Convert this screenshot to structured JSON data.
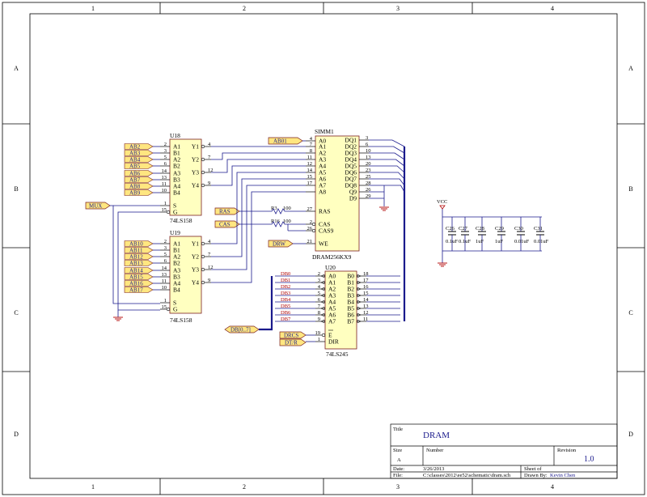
{
  "frame": {
    "cols": [
      "1",
      "2",
      "3",
      "4"
    ],
    "rows": [
      "A",
      "B",
      "C",
      "D"
    ]
  },
  "u18": {
    "ref": "U18",
    "part": "74LS158",
    "inputs": [
      "A1",
      "B1",
      "A2",
      "B2",
      "A3",
      "B3",
      "A4",
      "B4"
    ],
    "input_pins": [
      "2",
      "3",
      "5",
      "6",
      "14",
      "13",
      "11",
      "10"
    ],
    "outputs": [
      "Y1",
      "Y2",
      "Y3",
      "Y4"
    ],
    "output_pins": [
      "4",
      "7",
      "12",
      "9"
    ],
    "ctrl": [
      "S",
      "G"
    ],
    "ctrl_pins": [
      "1",
      "15"
    ],
    "ports": [
      "AB2",
      "AB3",
      "AB4",
      "AB5",
      "AB6",
      "AB7",
      "AB8",
      "AB9"
    ]
  },
  "u19": {
    "ref": "U19",
    "part": "74LS158",
    "inputs": [
      "A1",
      "B1",
      "A2",
      "B2",
      "A3",
      "B3",
      "A4",
      "B4"
    ],
    "input_pins": [
      "2",
      "3",
      "5",
      "6",
      "14",
      "13",
      "11",
      "10"
    ],
    "outputs": [
      "Y1",
      "Y2",
      "Y3",
      "Y4"
    ],
    "output_pins": [
      "4",
      "7",
      "12",
      "9"
    ],
    "ctrl": [
      "S",
      "G"
    ],
    "ctrl_pins": [
      "1",
      "15"
    ],
    "ports": [
      "AB10",
      "AB11",
      "AB12",
      "AB13",
      "AB14",
      "AB15",
      "AB16",
      "AB17"
    ]
  },
  "mux_port": "MUX",
  "simm": {
    "ref": "SIMM1",
    "part": "DRAM256KX9",
    "addr": [
      "A0",
      "A1",
      "A2",
      "A3",
      "A4",
      "A5",
      "A6",
      "A7",
      "A8"
    ],
    "addr_pins": [
      "4",
      "7",
      "8",
      "11",
      "12",
      "14",
      "15",
      "17"
    ],
    "dq": [
      "DQ1",
      "DQ2",
      "DQ3",
      "DQ4",
      "DQ5",
      "DQ6",
      "DQ7",
      "DQ8",
      "Q9",
      "D9"
    ],
    "dq_pins": [
      "3",
      "6",
      "10",
      "13",
      "20",
      "23",
      "25",
      "28",
      "26",
      "29"
    ],
    "ctrl": [
      "RAS",
      "CAS",
      "CAS9",
      "WE"
    ],
    "ctrl_pins": [
      "27",
      "2",
      "26",
      "21"
    ],
    "a0_port": "AB01"
  },
  "ras_port": "RAS",
  "cas_port": "CAS",
  "drw_port": "DRW",
  "r3": {
    "ref": "R3",
    "value": "100"
  },
  "r16": {
    "ref": "R16",
    "value": "100"
  },
  "u20": {
    "ref": "U20",
    "part": "74LS245",
    "a": [
      "A0",
      "A1",
      "A2",
      "A3",
      "A4",
      "A5",
      "A6",
      "A7"
    ],
    "a_pins": [
      "2",
      "3",
      "4",
      "5",
      "6",
      "7",
      "8",
      "9"
    ],
    "b": [
      "B0",
      "B1",
      "B2",
      "B3",
      "B4",
      "B5",
      "B6",
      "B7"
    ],
    "b_pins": [
      "18",
      "17",
      "16",
      "15",
      "14",
      "13",
      "12",
      "11"
    ],
    "e": "E",
    "dir": "DIR",
    "e_pin": "19",
    "dir_pin": "1",
    "db_nets": [
      "DB0",
      "DB1",
      "DB2",
      "DB3",
      "DB4",
      "DB5",
      "DB6",
      "DB7"
    ]
  },
  "dbus_port": "DB[0..7]",
  "drcs_port": "DRCS",
  "dtr_port": "DT/R",
  "vcc": "VCC",
  "caps": [
    {
      "ref": "C26",
      "value": "0.1uF"
    },
    {
      "ref": "C27",
      "value": "0.1uF"
    },
    {
      "ref": "C28",
      "value": "1uF"
    },
    {
      "ref": "C29",
      "value": "1uF"
    },
    {
      "ref": "C30",
      "value": "0.01uF"
    },
    {
      "ref": "C31",
      "value": "0.01uF"
    }
  ],
  "title_block": {
    "title_label": "Title",
    "title": "DRAM",
    "size_label": "Size",
    "size": "A",
    "number_label": "Number",
    "revision_label": "Revision",
    "revision": "1.0",
    "date_label": "Date:",
    "date": "3/26/2013",
    "file_label": "File:",
    "file": "C:\\classes\\2012\\ee52\\schematic\\dram.sch",
    "sheet_label": "Sheet    of",
    "drawn_label": "Drawn By:",
    "drawn_by": "Kevin Chen"
  },
  "colors": {
    "wire": "#1a1a8c",
    "bus": "#1a1a8c",
    "part_fill": "#ffffc0",
    "port_fill": "#ffe680",
    "net_label": "#b00000",
    "power": "#b00000"
  }
}
